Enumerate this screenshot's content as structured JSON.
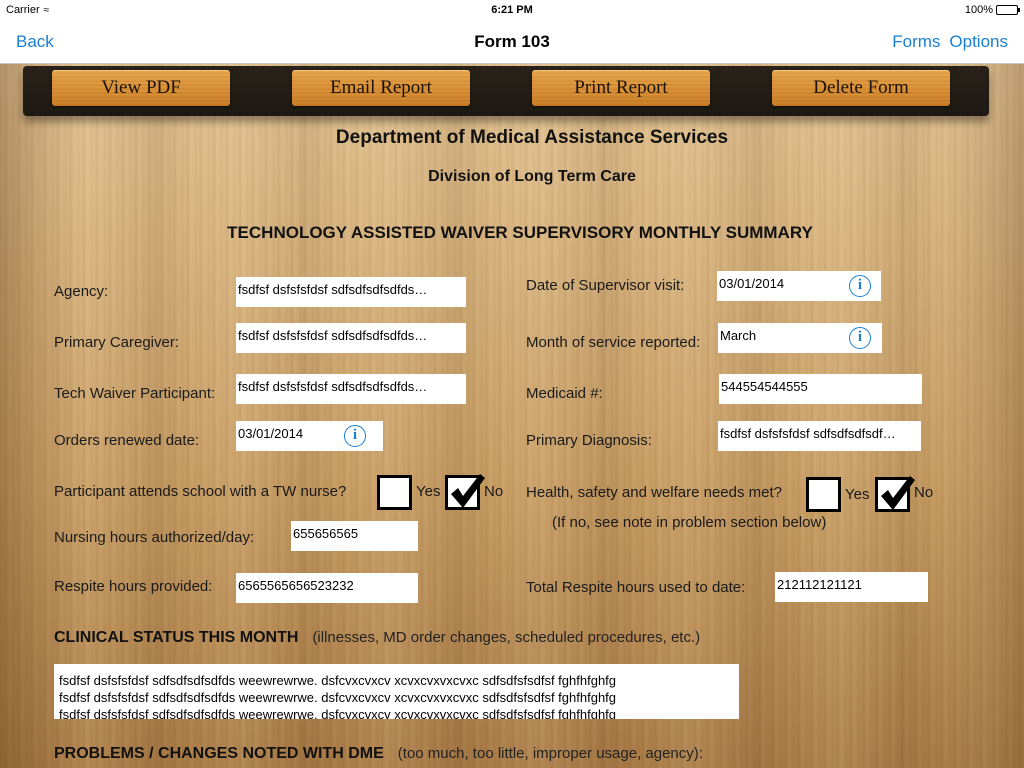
{
  "status_bar": {
    "carrier": "Carrier",
    "time": "6:21 PM",
    "battery": "100%",
    "battery_level": 1.0
  },
  "nav": {
    "back": "Back",
    "title": "Form 103",
    "forms": "Forms",
    "options": "Options"
  },
  "toolbar": {
    "view_pdf": "View PDF",
    "email_report": "Email Report",
    "print_report": "Print Report",
    "delete_form": "Delete Form"
  },
  "header": {
    "department": "Department of Medical Assistance Services",
    "division": "Division of Long Term Care",
    "form_title": "TECHNOLOGY ASSISTED WAIVER SUPERVISORY MONTHLY SUMMARY"
  },
  "fields": {
    "agency": {
      "label": "Agency:",
      "value": "fsdfsf dsfsfsfdsf sdfsdfsdfsdfds…"
    },
    "primary_caregiver": {
      "label": "Primary Caregiver:",
      "value": "fsdfsf dsfsfsfdsf sdfsdfsdfsdfds…"
    },
    "tech_waiver_participant": {
      "label": "Tech Waiver Participant:",
      "value": "fsdfsf dsfsfsfdsf sdfsdfsdfsdfds…"
    },
    "orders_renewed_date": {
      "label": "Orders renewed date:",
      "value": "03/01/2014"
    },
    "date_supervisor_visit": {
      "label": "Date of Supervisor visit:",
      "value": "03/01/2014"
    },
    "month_of_service": {
      "label": "Month of service reported:",
      "value": "March"
    },
    "medicaid": {
      "label": "Medicaid #:",
      "value": "544554544555"
    },
    "primary_diagnosis": {
      "label": "Primary Diagnosis:",
      "value": "fsdfsf dsfsfsfdsf sdfsdfsdfsdf…"
    },
    "nursing_hours": {
      "label": "Nursing hours authorized/day:",
      "value": "655656565"
    },
    "respite_hours": {
      "label": "Respite hours provided:",
      "value": "6565565656523232"
    },
    "total_respite_hours": {
      "label": "Total Respite hours used to date:",
      "value": "212112121121"
    }
  },
  "questions": {
    "school_nurse": {
      "label": "Participant attends school with a TW nurse?",
      "yes": "Yes",
      "no": "No",
      "selected": "No"
    },
    "health_safety": {
      "label": "Health, safety and welfare needs met?",
      "yes": "Yes",
      "no": "No",
      "selected": "No",
      "note": "(If no, see note in problem section below)"
    }
  },
  "clinical_status": {
    "title": "CLINICAL STATUS THIS MONTH",
    "subtitle": "(illnesses, MD order changes, scheduled procedures, etc.)",
    "lines": [
      "fsdfsf dsfsfsfdsf sdfsdfsdfsdfds weewrewrwe. dsfcvxcvxcv xcvxcvxvxcvxc sdfsdfsfsdfsf fghfhfghfg",
      "fsdfsf dsfsfsfdsf sdfsdfsdfsdfds weewrewrwe. dsfcvxcvxcv xcvxcvxvxcvxc sdfsdfsfsdfsf fghfhfghfg",
      "fsdfsf dsfsfsfdsf sdfsdfsdfsdfds weewrewrwe. dsfcvxcvxcv xcvxcvxvxcvxc sdfsdfsfsdfsf fghfhfghfg"
    ]
  },
  "dme_problems": {
    "title": "PROBLEMS / CHANGES NOTED WITH DME",
    "subtitle": "(too much, too little, improper usage, agency):"
  },
  "colors": {
    "ios_blue": "#1a7fd4",
    "toolbar_dark": "#1d1812",
    "wood_button": "#d88f34"
  }
}
